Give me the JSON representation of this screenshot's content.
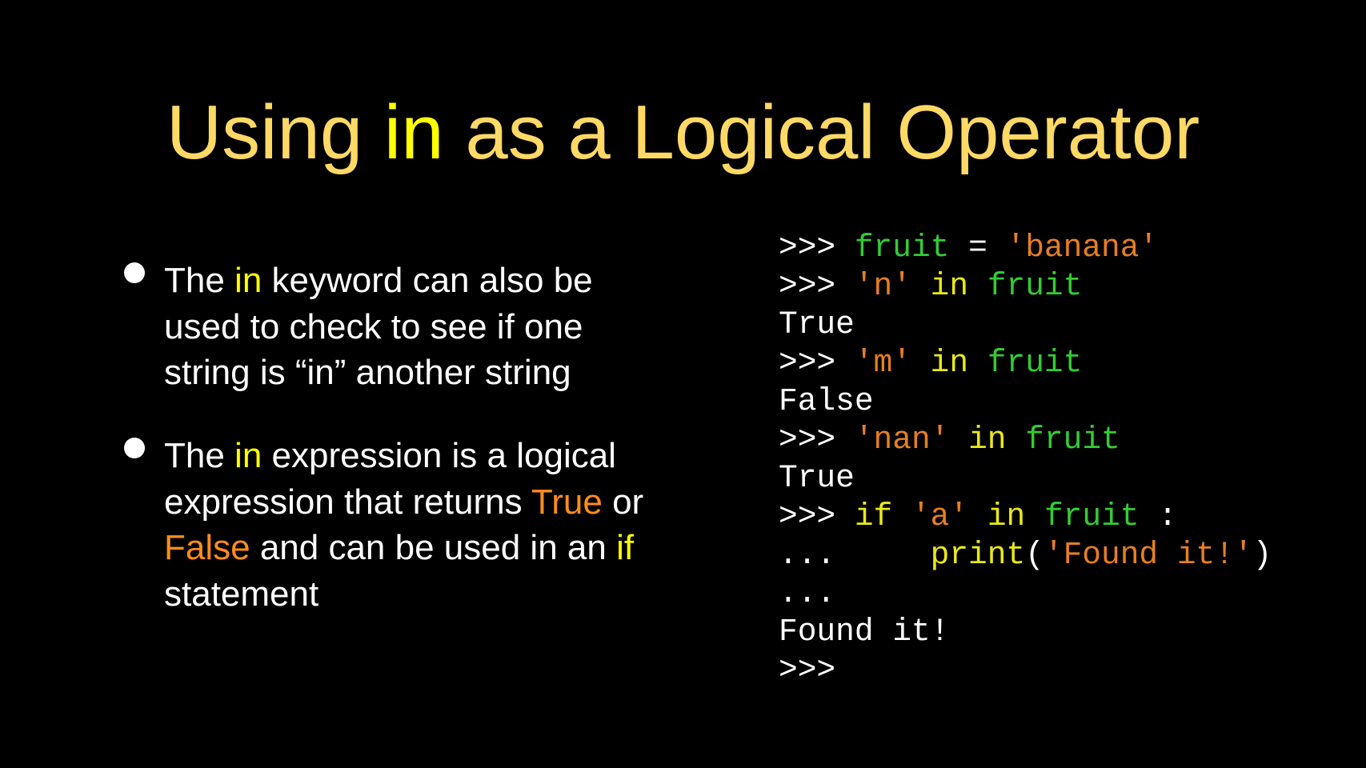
{
  "slide": {
    "title": {
      "before": "Using ",
      "keyword": "in",
      "after": " as a Logical Operator"
    },
    "bullets": [
      {
        "p1": "The ",
        "k1": "in",
        "p2": " keyword can also be used to check to see if one string is “in” another string"
      },
      {
        "p1": "The ",
        "k1": "in",
        "p2": " expression is a logical expression that returns ",
        "k2": "True",
        "p3": " or ",
        "k3": "False",
        "p4": " and can be used in an ",
        "k4": "if",
        "p5": " statement"
      }
    ],
    "code_lines": [
      [
        [
          "prompt",
          ">>> "
        ],
        [
          "var",
          "fruit"
        ],
        [
          "plain",
          " = "
        ],
        [
          "str",
          "'banana'"
        ]
      ],
      [
        [
          "prompt",
          ">>> "
        ],
        [
          "str",
          "'n'"
        ],
        [
          "plain",
          " "
        ],
        [
          "kw",
          "in"
        ],
        [
          "plain",
          " "
        ],
        [
          "var",
          "fruit"
        ]
      ],
      [
        [
          "out",
          "True"
        ]
      ],
      [
        [
          "prompt",
          ">>> "
        ],
        [
          "str",
          "'m'"
        ],
        [
          "plain",
          " "
        ],
        [
          "kw",
          "in"
        ],
        [
          "plain",
          " "
        ],
        [
          "var",
          "fruit"
        ]
      ],
      [
        [
          "out",
          "False"
        ]
      ],
      [
        [
          "prompt",
          ">>> "
        ],
        [
          "str",
          "'nan'"
        ],
        [
          "plain",
          " "
        ],
        [
          "kw",
          "in"
        ],
        [
          "plain",
          " "
        ],
        [
          "var",
          "fruit"
        ]
      ],
      [
        [
          "out",
          "True"
        ]
      ],
      [
        [
          "prompt",
          ">>> "
        ],
        [
          "kw",
          "if"
        ],
        [
          "plain",
          " "
        ],
        [
          "str",
          "'a'"
        ],
        [
          "plain",
          " "
        ],
        [
          "kw",
          "in"
        ],
        [
          "plain",
          " "
        ],
        [
          "var",
          "fruit"
        ],
        [
          "plain",
          " :"
        ]
      ],
      [
        [
          "prompt",
          "...     "
        ],
        [
          "fn",
          "print"
        ],
        [
          "plain",
          "("
        ],
        [
          "str",
          "'Found it!'"
        ],
        [
          "plain",
          ")"
        ]
      ],
      [
        [
          "prompt",
          "..."
        ]
      ],
      [
        [
          "out",
          "Found it!"
        ]
      ],
      [
        [
          "prompt",
          ">>>"
        ]
      ]
    ],
    "colors": {
      "background": "#000000",
      "title": "#FFD966",
      "keyword_yellow": "#FFFF00",
      "boolean_orange": "#FF8C1A",
      "code_variable_green": "#33CC33",
      "code_string_orange": "#E67E22",
      "code_keyword_yellow": "#E8E81A",
      "body_text": "#FFFFFF"
    }
  }
}
